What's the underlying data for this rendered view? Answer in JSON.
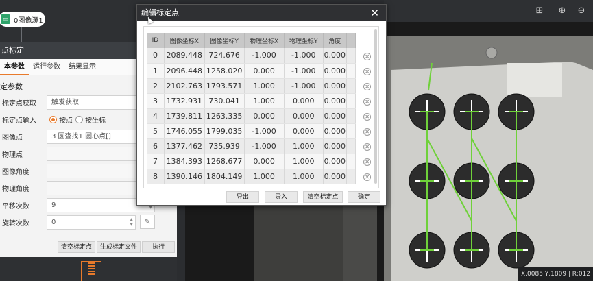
{
  "flow": {
    "node_label": "0图像源1",
    "node_icon": "image-source-icon"
  },
  "left_panel": {
    "title": "点标定",
    "tabs": [
      "本参数",
      "运行参数",
      "结果显示"
    ],
    "section": "定参数",
    "rows": {
      "acquire": {
        "label": "标定点获取",
        "value": "触发获取"
      },
      "input": {
        "label": "标定点输入",
        "option1": "按点",
        "option2": "按坐标",
        "selected": "按点"
      },
      "image_point": {
        "label": "图像点",
        "value": "3 圆查找1.圆心点[]"
      },
      "phys_point": {
        "label": "物理点",
        "value": ""
      },
      "image_angle": {
        "label": "图像角度",
        "value": ""
      },
      "phys_angle": {
        "label": "物理角度",
        "value": ""
      },
      "translate": {
        "label": "平移次数",
        "value": "9"
      },
      "rotate": {
        "label": "旋转次数",
        "value": "0"
      }
    },
    "buttons": {
      "clear": "清空标定点",
      "generate": "生成标定文件",
      "run": "执行"
    }
  },
  "dialog": {
    "title": "编辑标定点",
    "columns": [
      "ID",
      "图像坐标X",
      "图像坐标Y",
      "物理坐标X",
      "物理坐标Y",
      "角度"
    ],
    "rows": [
      [
        "0",
        "2089.448",
        "724.676",
        "-1.000",
        "-1.000",
        "0.000"
      ],
      [
        "1",
        "2096.448",
        "1258.020",
        "0.000",
        "-1.000",
        "0.000"
      ],
      [
        "2",
        "2102.763",
        "1793.571",
        "1.000",
        "-1.000",
        "0.000"
      ],
      [
        "3",
        "1732.931",
        "730.041",
        "1.000",
        "0.000",
        "0.000"
      ],
      [
        "4",
        "1739.811",
        "1263.335",
        "0.000",
        "0.000",
        "0.000"
      ],
      [
        "5",
        "1746.055",
        "1799.035",
        "-1.000",
        "0.000",
        "0.000"
      ],
      [
        "6",
        "1377.462",
        "735.939",
        "-1.000",
        "1.000",
        "0.000"
      ],
      [
        "7",
        "1384.393",
        "1268.677",
        "0.000",
        "1.000",
        "0.000"
      ],
      [
        "8",
        "1390.146",
        "1804.149",
        "1.000",
        "1.000",
        "0.000"
      ]
    ],
    "buttons": {
      "export": "导出",
      "import": "导入",
      "clear": "清空标定点",
      "confirm": "确定"
    }
  },
  "viewer": {
    "page_index": "24",
    "status": "X,0085  Y,1809  |  R:012",
    "toolbar_icons": [
      "fit-icon",
      "zoom-in-icon",
      "zoom-out-icon"
    ]
  }
}
